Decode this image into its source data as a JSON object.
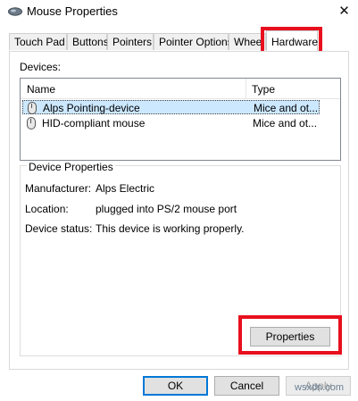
{
  "window": {
    "title": "Mouse Properties",
    "close_glyph": "✕"
  },
  "tabs": [
    {
      "label": "Touch Pad"
    },
    {
      "label": "Buttons"
    },
    {
      "label": "Pointers"
    },
    {
      "label": "Pointer Options"
    },
    {
      "label": "Wheel"
    },
    {
      "label": "Hardware",
      "active": true
    }
  ],
  "devices": {
    "label": "Devices:",
    "columns": {
      "name": "Name",
      "type": "Type"
    },
    "rows": [
      {
        "name": "Alps Pointing-device",
        "type": "Mice and ot...",
        "selected": true
      },
      {
        "name": "HID-compliant mouse",
        "type": "Mice and ot..."
      }
    ]
  },
  "device_properties": {
    "label": "Device Properties",
    "manufacturer_key": "Manufacturer:",
    "manufacturer_value": "Alps Electric",
    "location_key": "Location:",
    "location_value": "plugged into PS/2 mouse port",
    "status_key": "Device status:",
    "status_value": "This device is working properly.",
    "properties_button": "Properties"
  },
  "buttons": {
    "ok": "OK",
    "cancel": "Cancel",
    "apply": "Apply"
  },
  "watermark": "wsxdn.com",
  "colors": {
    "highlight": "#e8101e",
    "selection": "#cce8ff",
    "accent": "#0078d7"
  }
}
